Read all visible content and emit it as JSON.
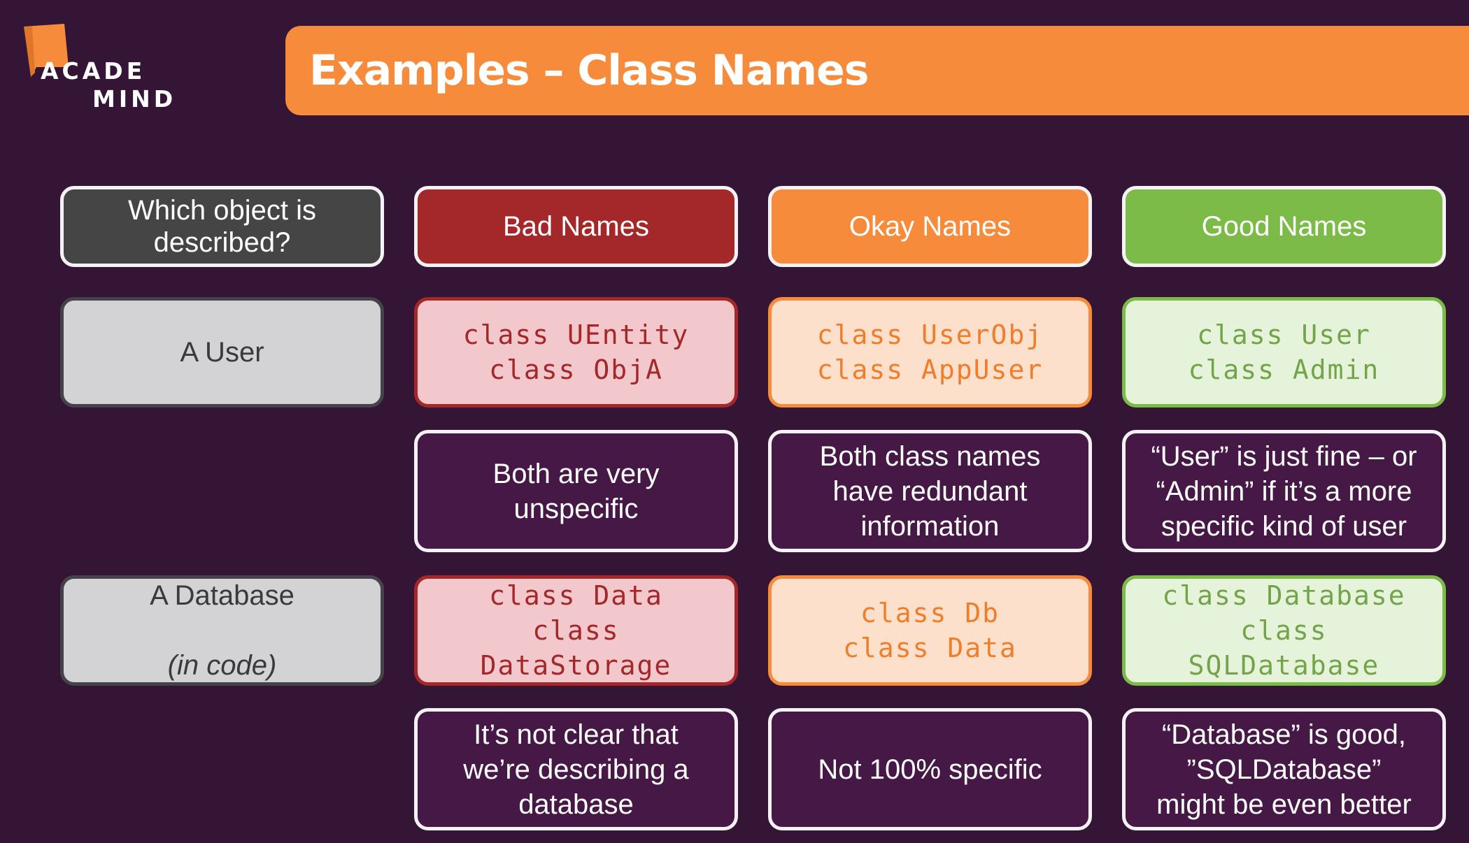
{
  "logo": {
    "line1": "ACADE",
    "line2": "MIND",
    "colors": {
      "flag": "#f58b3b",
      "text": "#ffffff"
    }
  },
  "header": {
    "title": "Examples – Class Names",
    "color": "#f58b3b"
  },
  "columns": {
    "object": "Which object is\ndescribed?",
    "bad": "Bad Names",
    "okay": "Okay Names",
    "good": "Good Names"
  },
  "rows": [
    {
      "object": "A User",
      "object_note": "",
      "bad": "class UEntity\nclass ObjA",
      "okay": "class UserObj\nclass AppUser",
      "good": "class User\nclass Admin",
      "bad_note": "Both are very\nunspecific",
      "okay_note": "Both class names\nhave redundant\ninformation",
      "good_note": "“User” is just fine – or\n“Admin” if it’s a more\nspecific kind of user"
    },
    {
      "object": "A Database",
      "object_note": "(in code)",
      "bad": "class Data\nclass\nDataStorage",
      "okay": "class Db\nclass Data",
      "good": "class Database\nclass\nSQLDatabase",
      "bad_note": "It’s not clear that\nwe’re describing a\ndatabase",
      "okay_note": "Not 100% specific",
      "good_note": "“Database” is good,\n”SQLDatabase”\nmight be even better"
    }
  ],
  "colors": {
    "background": "#351535",
    "bad": "#a4272a",
    "okay": "#f58b3b",
    "good": "#7cbb48",
    "neutral": "#454546"
  }
}
